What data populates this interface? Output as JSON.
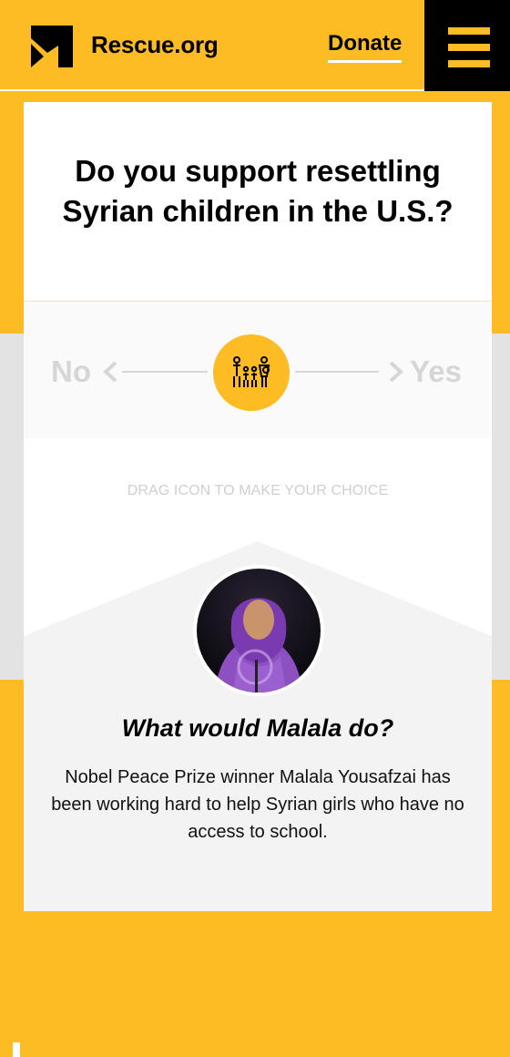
{
  "header": {
    "logo_text": "Rescue.org",
    "donate_label": "Donate",
    "menu_icon": "hamburger-icon"
  },
  "poll": {
    "question": "Do you support resettling Syrian children in the U.S.?",
    "no_label": "No",
    "yes_label": "Yes",
    "knob_icon": "family-icon",
    "hint": "DRAG ICON TO MAKE YOUR CHOICE"
  },
  "feature": {
    "title": "What would Malala do?",
    "description": "Nobel Peace Prize winner Malala Yousafzai has been working hard to help Syrian girls who have no access to school."
  },
  "colors": {
    "brand_yellow": "#fdbb24",
    "black": "#000000",
    "muted_gray": "#d6d6d6",
    "card_white": "#ffffff",
    "panel_gray": "#f3f3f3"
  }
}
